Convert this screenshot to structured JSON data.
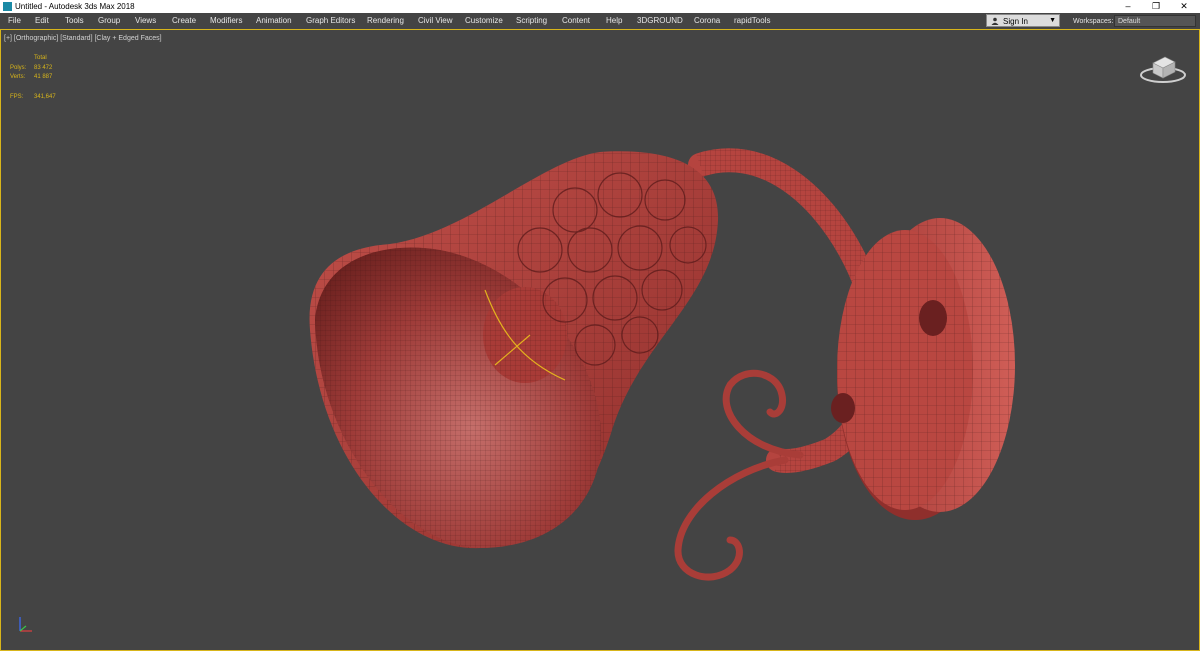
{
  "window": {
    "title": "Untitled - Autodesk 3ds Max 2018",
    "minimize": "–",
    "restore": "❐",
    "close": "✕"
  },
  "menu": [
    "File",
    "Edit",
    "Tools",
    "Group",
    "Views",
    "Create",
    "Modifiers",
    "Animation",
    "Graph Editors",
    "Rendering",
    "Civil View",
    "Customize",
    "Scripting",
    "Content",
    "Help",
    "3DGROUND",
    "Corona",
    "rapidTools"
  ],
  "signin": {
    "label": "Sign In",
    "icon": "user-icon"
  },
  "workspaces": {
    "label": "Workspaces:",
    "value": "Default"
  },
  "viewport": {
    "label": "[+] [Orthographic] [Standard] [Clay + Edged Faces]",
    "stats": {
      "header": "Total",
      "polys_label": "Polys:",
      "polys": "83 472",
      "verts_label": "Verts:",
      "verts": "41 887",
      "fps_label": "FPS:",
      "fps": "341,647"
    }
  },
  "colors": {
    "accent": "#d8b51a",
    "viewport_bg": "#444444",
    "model": "#b8443f"
  }
}
